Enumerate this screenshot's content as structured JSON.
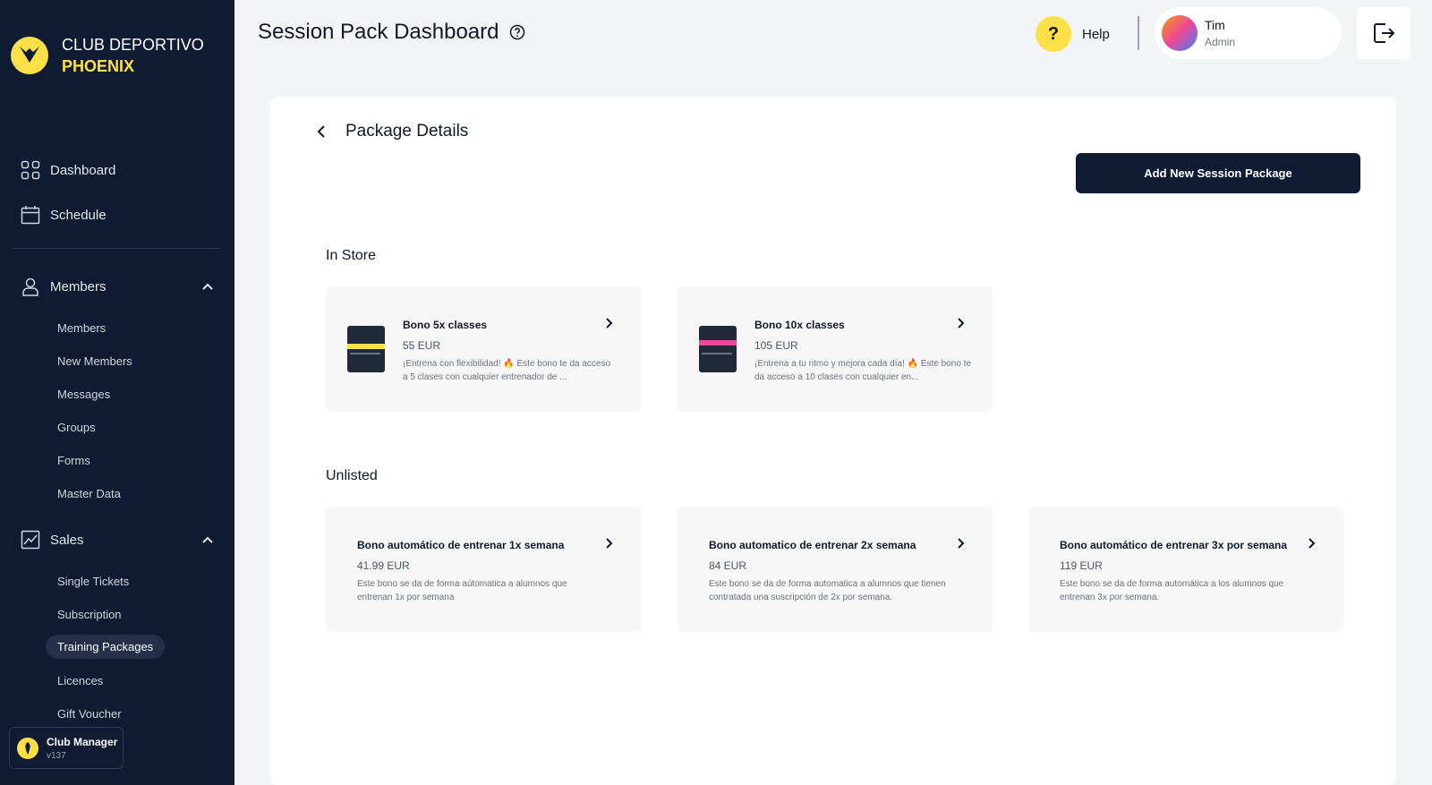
{
  "brand": {
    "line1": "CLUB DEPORTIVO",
    "line2": "PHOENIX"
  },
  "sidebar": {
    "main_items": [
      {
        "label": "Dashboard",
        "icon": "grid-icon"
      },
      {
        "label": "Schedule",
        "icon": "calendar-icon"
      }
    ],
    "members": {
      "label": "Members",
      "items": [
        "Members",
        "New Members",
        "Messages",
        "Groups",
        "Forms",
        "Master Data"
      ]
    },
    "sales": {
      "label": "Sales",
      "items": [
        "Single Tickets",
        "Subscription",
        "Training Packages",
        "Licences",
        "Gift Voucher"
      ],
      "active": "Training Packages"
    },
    "footer": {
      "title": "Club Manager",
      "version": "v137"
    }
  },
  "header": {
    "title": "Session Pack Dashboard",
    "help_label": "Help",
    "user": {
      "name": "Tim",
      "role": "Admin"
    }
  },
  "panel": {
    "title": "Package Details",
    "add_button": "Add New Session Package",
    "sections": [
      {
        "title": "In Store",
        "cards": [
          {
            "title": "Bono 5x classes",
            "price": "55 EUR",
            "desc": "¡Entrena con flexibilidad! 🔥 Este bono te da acceso a 5 clases con cualquier entrenador de ..."
          },
          {
            "title": "Bono 10x classes",
            "price": "105 EUR",
            "desc": "¡Entrena a tu ritmo y mejora cada día! 🔥 Este bono te da acceso a 10 clases con cualquier en..."
          }
        ]
      },
      {
        "title": "Unlisted",
        "cards": [
          {
            "title": "Bono automático de entrenar 1x semana",
            "price": "41.99 EUR",
            "desc": "Este bono se da de forma aútomatica a alumnos que entrenan 1x por semana"
          },
          {
            "title": "Bono automatico de entrenar 2x semana",
            "price": "84 EUR",
            "desc": "Este bono se da de forma automatica a alumnos que tienen contratada una suscripción de 2x por semana."
          },
          {
            "title": "Bono automático de entrenar 3x por semana",
            "price": "119 EUR",
            "desc": "Este bono se da de forma automática a los alumnos que entrenan 3x por semana."
          }
        ]
      }
    ]
  },
  "colors": {
    "sidebar_bg": "#0f1b33",
    "accent": "#fde047",
    "page_bg": "#f3f4f6"
  }
}
